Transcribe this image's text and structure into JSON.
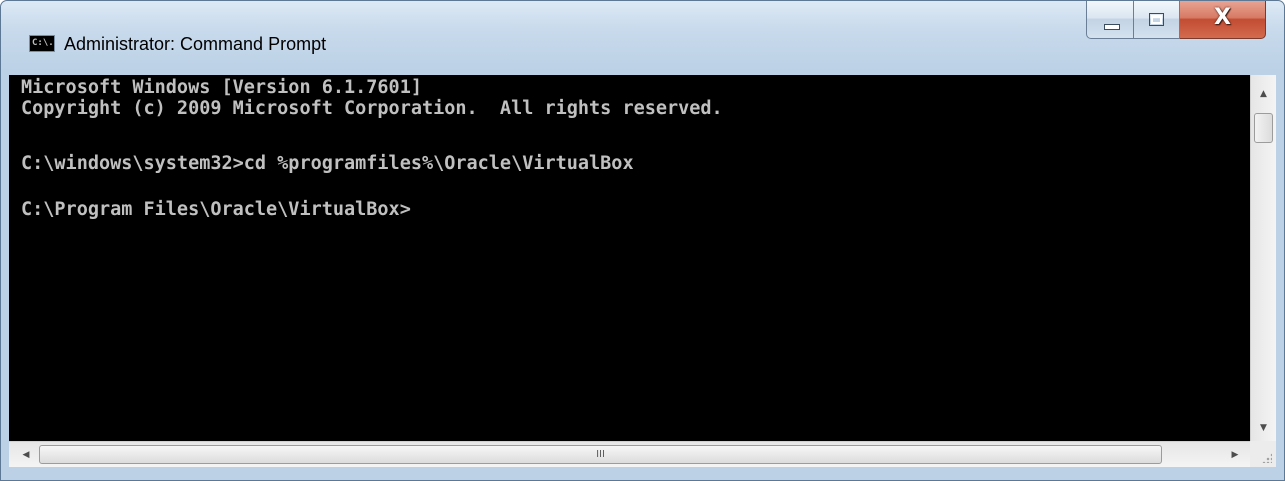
{
  "window": {
    "title": "Administrator: Command Prompt",
    "icon_text": "C:\\.",
    "icon": "console-icon"
  },
  "caption_buttons": {
    "minimize_icon": "minimize-icon",
    "maximize_icon": "maximize-icon",
    "close_icon": "close-icon",
    "close_glyph": "X",
    "close_color": "#c24d33"
  },
  "console": {
    "background": "#000000",
    "foreground": "#c0c0c0",
    "lines": [
      "Microsoft Windows [Version 6.1.7601]",
      "Copyright (c) 2009 Microsoft Corporation.  All rights reserved.",
      "",
      "C:\\windows\\system32>cd %programfiles%\\Oracle\\VirtualBox",
      "",
      "C:\\Program Files\\Oracle\\VirtualBox>"
    ]
  },
  "scrollbars": {
    "up_arrow": "▲",
    "down_arrow": "▼",
    "left_arrow": "◀",
    "right_arrow": "▶",
    "grip": "III"
  }
}
